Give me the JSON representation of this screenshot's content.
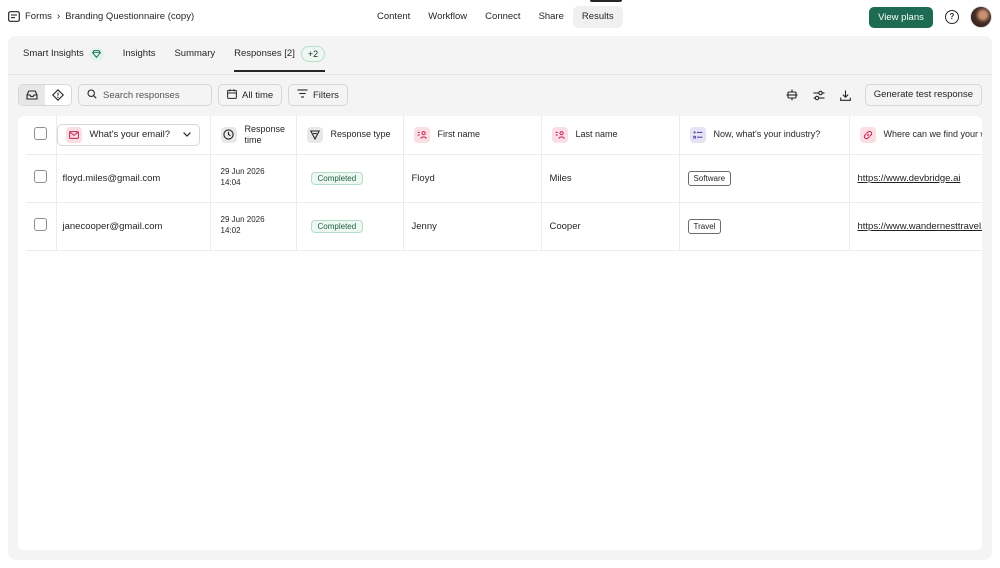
{
  "topbar": {
    "breadcrumb_root": "Forms",
    "breadcrumb_current": "Branding Questionnaire (copy)",
    "nav_tabs": [
      "Content",
      "Workflow",
      "Connect",
      "Share",
      "Results"
    ],
    "active_tab": "Results",
    "view_plans_label": "View plans",
    "help_label": "?"
  },
  "subtabs": {
    "items": [
      "Smart Insights",
      "Insights",
      "Summary",
      "Responses [2]"
    ],
    "active": "Responses [2]",
    "extra_count": "+2"
  },
  "toolbar": {
    "search_placeholder": "Search responses",
    "time_filter_label": "All time",
    "filters_label": "Filters",
    "generate_label": "Generate test response"
  },
  "table": {
    "email_column_label": "What's your email?",
    "columns": {
      "response_time": "Response time",
      "response_type": "Response type",
      "first_name": "First name",
      "last_name": "Last name",
      "industry": "Now, what's your industry?",
      "website": "Where can we find your website?"
    },
    "rows": [
      {
        "email": "floyd.miles@gmail.com",
        "date": "29 Jun 2026",
        "time": "14:04",
        "type": "Completed",
        "first_name": "Floyd",
        "last_name": "Miles",
        "industry": "Software",
        "website": "https://www.devbridge.ai"
      },
      {
        "email": "janecooper@gmail.com",
        "date": "29 Jun 2026",
        "time": "14:02",
        "type": "Completed",
        "first_name": "Jenny",
        "last_name": "Cooper",
        "industry": "Travel",
        "website": "https://www.wandernesttravel.com"
      }
    ]
  },
  "colors": {
    "accent": "#1d6b52",
    "panel_bg": "#f4f4f4",
    "icon_pink": "#fbdde6",
    "completed_green": "#eef8f2"
  },
  "icons": {
    "forms": "forms-icon",
    "smart_insights": "gem-icon",
    "inbox": "inbox-icon",
    "alert": "alert-icon",
    "search": "search-icon",
    "calendar": "calendar-icon",
    "filter": "filter-icon",
    "collapse": "collapse-rows-icon",
    "settings": "sliders-icon",
    "download": "download-icon"
  }
}
